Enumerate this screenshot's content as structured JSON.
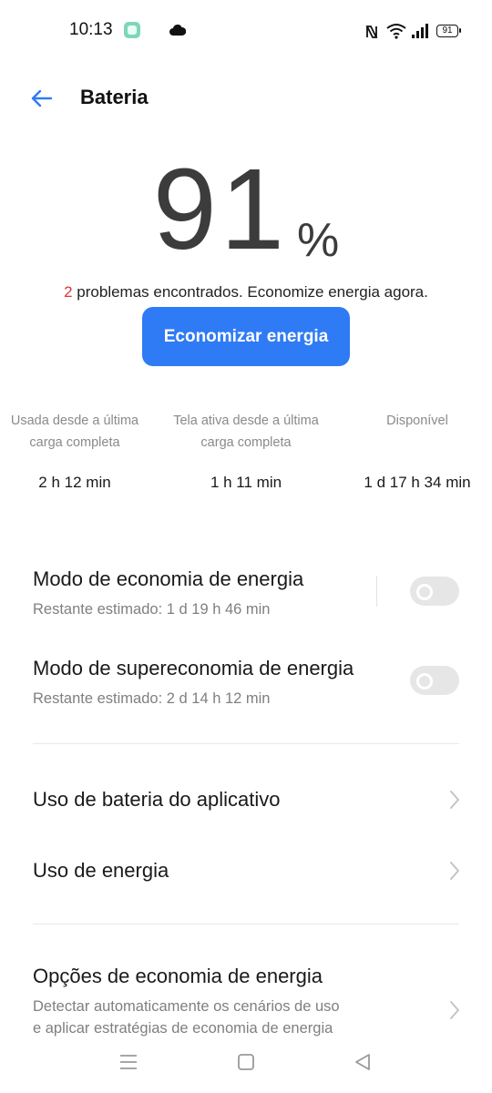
{
  "status_bar": {
    "time": "10:13",
    "battery_level": "91",
    "icons": [
      "app-notification-icon",
      "cloud-icon",
      "nfc-icon",
      "wifi-icon",
      "signal-icon",
      "battery-icon"
    ]
  },
  "header": {
    "title": "Bateria",
    "back_icon": "arrow-left-icon",
    "accent": "#2f7bf5"
  },
  "battery": {
    "percent": "91",
    "unit": "%",
    "problems_count": "2",
    "problems_text": " problemas encontrados. Economize energia agora.",
    "problems_color": "#e2333a",
    "save_button": "Economizar energia"
  },
  "stats": [
    {
      "label_line1": "Usada desde a última",
      "label_line2": "carga completa",
      "value": "2 h 12 min"
    },
    {
      "label_line1": "Tela ativa desde a última",
      "label_line2": "carga completa",
      "value": "1 h 11 min"
    },
    {
      "label_line1": "Disponível",
      "label_line2": "",
      "value": "1 d 17 h 34 min"
    }
  ],
  "modes": [
    {
      "title": "Modo de economia de energia",
      "subtitle": "Restante estimado:  1 d 19 h 46 min",
      "enabled": false
    },
    {
      "title": "Modo de supereconomia de energia",
      "subtitle": "Restante estimado:  2 d 14 h 12 min",
      "enabled": false
    }
  ],
  "links": [
    {
      "title": "Uso de bateria do aplicativo"
    },
    {
      "title": "Uso de energia"
    }
  ],
  "options": {
    "title": "Opções de economia de energia",
    "description_line1": "Detectar automaticamente os cenários de uso",
    "description_line2": "e aplicar estratégias de economia de energia"
  },
  "nav_bar": {
    "icons": [
      "menu-icon",
      "home-icon",
      "back-triangle-icon"
    ]
  }
}
